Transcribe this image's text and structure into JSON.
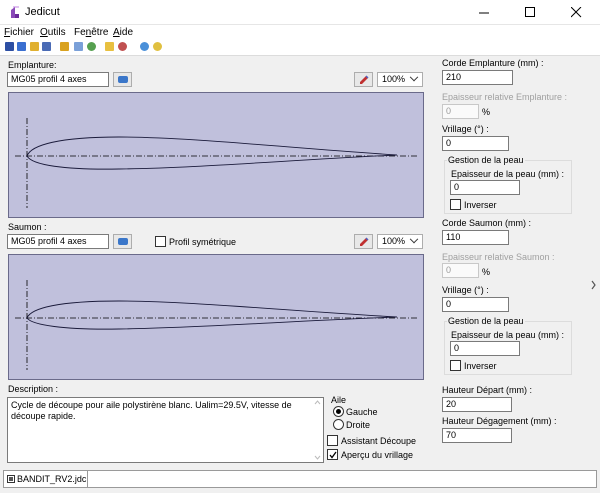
{
  "window": {
    "title": "Jedicut"
  },
  "menu": {
    "items": [
      {
        "first": "F",
        "rest": "ichier"
      },
      {
        "first": "O",
        "rest": "utils"
      },
      {
        "first": "",
        "mid": "Fe",
        "ul": "n",
        "rest": "être"
      },
      {
        "first": "A",
        "rest": "ide"
      }
    ]
  },
  "toolbar": {
    "icons": [
      "new-file-icon",
      "open-file-icon",
      "folder-icon",
      "save-icon",
      "settings-icon",
      "table-icon",
      "globe-icon",
      "arrow-icon",
      "cut-icon",
      "info-icon",
      "help-icon"
    ],
    "colors": [
      "#2d4fa3",
      "#3a6fd0",
      "#e0b030",
      "#4a6bb5",
      "#d9a220",
      "#7aa0d8",
      "#56a050",
      "#e8c040",
      "#c05050",
      "#4a90d9",
      "#e0c040"
    ]
  },
  "emplanture": {
    "label": "Emplanture:",
    "profile_value": "MG05 profil 4 axes",
    "zoom_value": "100%"
  },
  "saumon": {
    "label": "Saumon :",
    "profile_value": "MG05 profil 4 axes",
    "zoom_value": "100%",
    "symmetric_label": "Profil symétrique",
    "symmetric_checked": false
  },
  "description": {
    "label": "Description :",
    "text": "Cycle de découpe pour aile polystirène blanc. Ualim=29.5V, vitesse de découpe rapide."
  },
  "aile": {
    "label": "Aile",
    "gauche_label": "Gauche",
    "droite_label": "Droite",
    "selected": "Gauche"
  },
  "options": {
    "assistant_label": "Assistant Découpe",
    "assistant_checked": false,
    "apercu_label": "Aperçu du vrillage",
    "apercu_checked": true
  },
  "right_panel": {
    "corde_emplanture_label": "Corde Emplanture (mm) :",
    "corde_emplanture_value": "210",
    "epaisseur_rel_emplanture_label": "Epaisseur relative Emplanture :",
    "epaisseur_rel_emplanture_value": "0",
    "percent1": "%",
    "vrillage1_label": "Vrillage (°) :",
    "vrillage1_value": "0",
    "peau1_group": "Gestion de la peau",
    "peau1_label": "Epaisseur de la peau (mm) :",
    "peau1_value": "0",
    "inverser1_label": "Inverser",
    "corde_saumon_label": "Corde Saumon (mm) :",
    "corde_saumon_value": "110",
    "epaisseur_rel_saumon_label": "Epaisseur relative Saumon :",
    "epaisseur_rel_saumon_value": "0",
    "percent2": "%",
    "vrillage2_label": "Vrillage (°) :",
    "vrillage2_value": "0",
    "peau2_group": "Gestion de la peau",
    "peau2_label": "Epaisseur de la peau (mm) :",
    "peau2_value": "0",
    "inverser2_label": "Inverser",
    "hauteur_depart_label": "Hauteur Départ (mm) :",
    "hauteur_depart_value": "20",
    "hauteur_degagement_label": "Hauteur Dégagement (mm) :",
    "hauteur_degagement_value": "70"
  },
  "statusbar": {
    "file_tab": "BANDIT_RV2.jdc"
  }
}
